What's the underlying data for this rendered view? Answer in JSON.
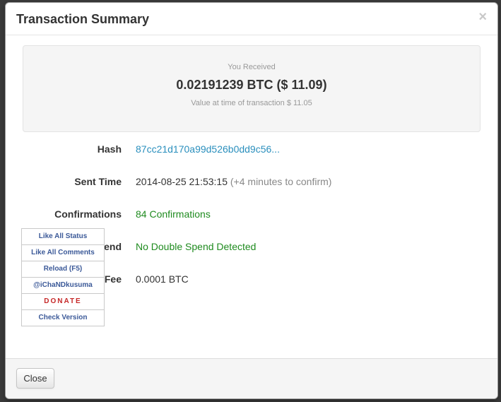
{
  "modal": {
    "title": "Transaction Summary",
    "close_symbol": "×"
  },
  "summary": {
    "label": "You Received",
    "amount": "0.02191239 BTC ($ 11.09)",
    "value_note": "Value at time of transaction $ 11.05"
  },
  "details": [
    {
      "label": "Hash",
      "value": "87cc21d170a99d526b0dd9c56...",
      "extra": ""
    },
    {
      "label": "Sent Time",
      "value": "2014-08-25 21:53:15",
      "extra": "(+4 minutes to confirm)"
    },
    {
      "label": "Confirmations",
      "value": "84 Confirmations",
      "extra": ""
    },
    {
      "label": "end",
      "value": "No Double Spend Detected",
      "extra": ""
    },
    {
      "label": "Fee",
      "value": "0.0001 BTC",
      "extra": ""
    }
  ],
  "footer": {
    "close_label": "Close"
  },
  "extension": {
    "items": [
      {
        "label": "Like All Status"
      },
      {
        "label": "Like All Comments"
      },
      {
        "label": "Reload (F5)"
      },
      {
        "label": "@iChaNDkusuma"
      },
      {
        "label": "DONATE"
      },
      {
        "label": "Check Version"
      }
    ]
  },
  "colors": {
    "link": "#2a8fbd",
    "success": "#1f8b1f",
    "extension_link": "#3b5998",
    "donate": "#c62828"
  }
}
